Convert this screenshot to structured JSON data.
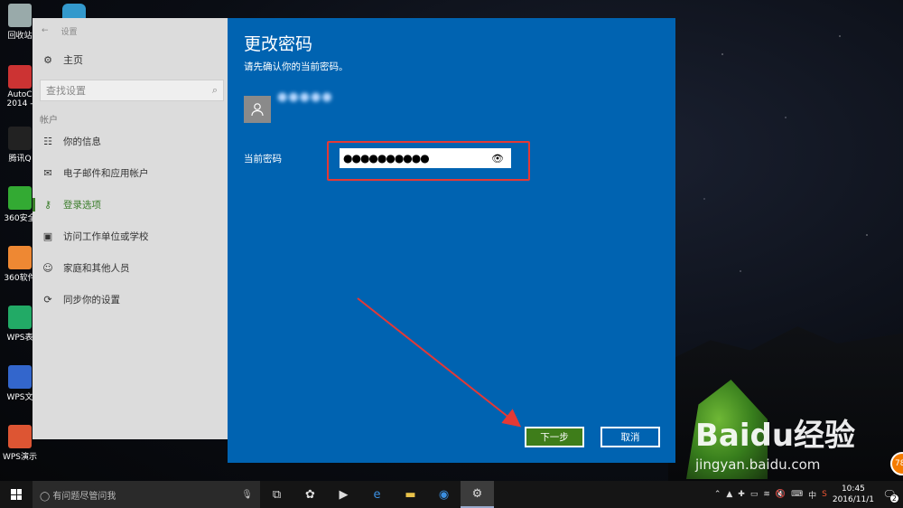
{
  "desktop": {
    "icons": [
      {
        "label": "回收站",
        "color": "#9aa"
      },
      {
        "label": "AutoC 2014 -",
        "color": "#c33"
      },
      {
        "label": "腾讯Q",
        "color": "#222"
      },
      {
        "label": "360安全",
        "color": "#3a3"
      },
      {
        "label": "360软件",
        "color": "#e83"
      },
      {
        "label": "WPS表",
        "color": "#2a6"
      },
      {
        "label": "WPS文",
        "color": "#36c"
      },
      {
        "label": "WPS演示",
        "color": "#d53"
      }
    ]
  },
  "settings": {
    "window_title": "设置",
    "home_label": "主页",
    "search_placeholder": "查找设置",
    "section": "帐户",
    "nav": [
      {
        "label": "你的信息",
        "icon": "person-card-icon"
      },
      {
        "label": "电子邮件和应用帐户",
        "icon": "mail-icon"
      },
      {
        "label": "登录选项",
        "icon": "key-icon",
        "active": true
      },
      {
        "label": "访问工作单位或学校",
        "icon": "briefcase-icon"
      },
      {
        "label": "家庭和其他人员",
        "icon": "people-icon"
      },
      {
        "label": "同步你的设置",
        "icon": "sync-icon"
      }
    ]
  },
  "dialog": {
    "title": "更改密码",
    "subtitle": "请先确认你的当前密码。",
    "username": "●●●●●",
    "field_label": "当前密码",
    "password_value": "●●●●●●●●●●",
    "next_label": "下一步",
    "cancel_label": "取消",
    "accent": "#0063b1",
    "next_color": "#3e7d1a",
    "highlight_color": "#e53935"
  },
  "watermark": {
    "logo": "Baidu经验",
    "url": "jingyan.baidu.com",
    "badge": "78"
  },
  "taskbar": {
    "search_placeholder": "有问题尽管问我",
    "ime": "中",
    "time": "10:45",
    "date": "2016/11/1",
    "notification_count": "2"
  }
}
